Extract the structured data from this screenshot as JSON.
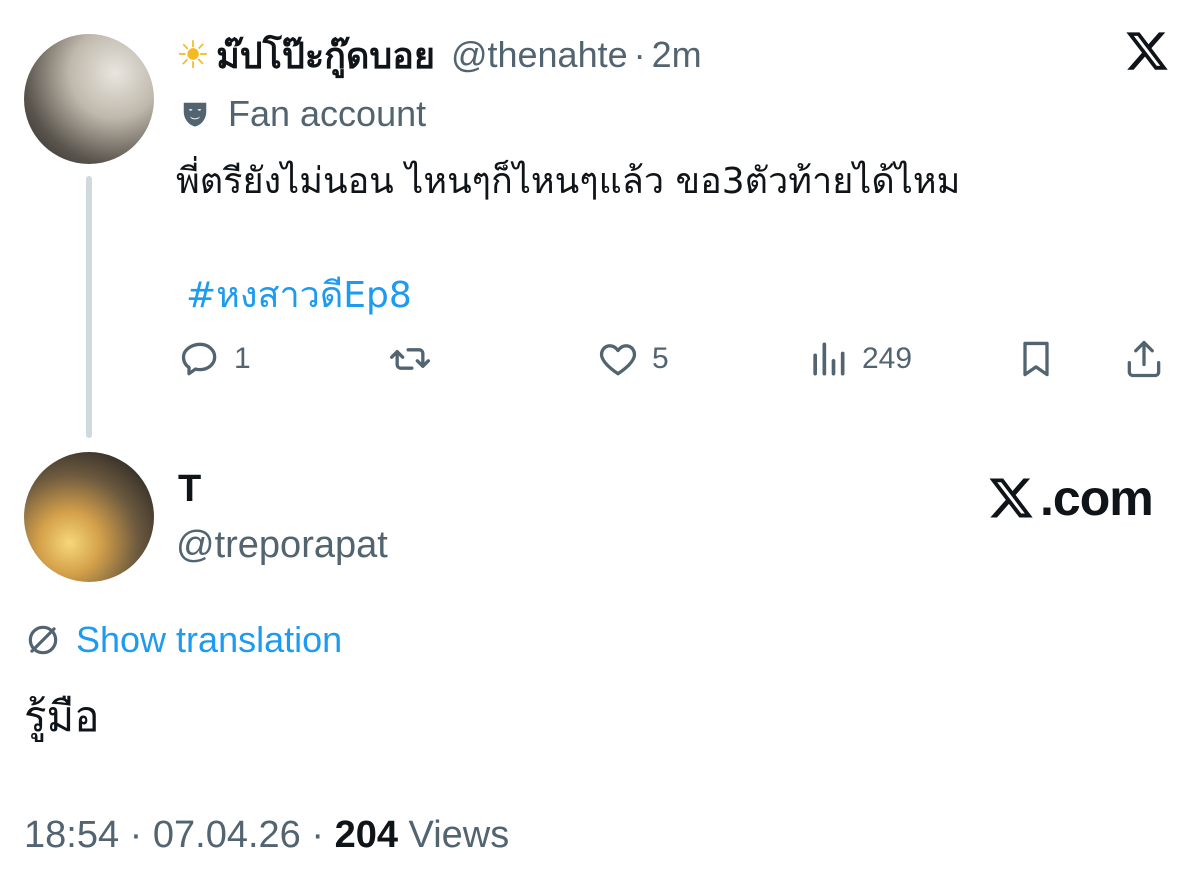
{
  "tweet": {
    "display_name": "ม๊ปโป๊ะกู๊ดบอย",
    "name_emoji": "☀",
    "handle": "@thenahte",
    "separator": "·",
    "time": "2m",
    "label": "Fan account",
    "text": "พี่ตรียังไม่นอน ไหนๆก็ไหนๆแล้ว ขอ3ตัวท้ายได้ไหม",
    "hashtag": "#หงสาวดีEp8",
    "actions": {
      "reply_count": "1",
      "retweet_count": "",
      "like_count": "5",
      "views_count": "249"
    }
  },
  "reply": {
    "display_name": "T",
    "handle": "@treporapat",
    "watermark": ".com",
    "show_translation": "Show translation",
    "text": "รู้มือ",
    "time": "18:54",
    "date": "07.04.26",
    "sep1": "·",
    "sep2": "·",
    "views_count": "204",
    "views_label": "Views"
  },
  "icons": {
    "brand": "x-logo-icon",
    "label": "mask-icon",
    "reply": "reply-icon",
    "retweet": "retweet-icon",
    "like": "heart-icon",
    "views": "views-icon",
    "bookmark": "bookmark-icon",
    "share": "share-icon",
    "translate": "globe-icon"
  },
  "colors": {
    "link": "#1d9bf0",
    "secondary": "#536471",
    "primary": "#0f1419",
    "thread_line": "#cfd9de"
  }
}
